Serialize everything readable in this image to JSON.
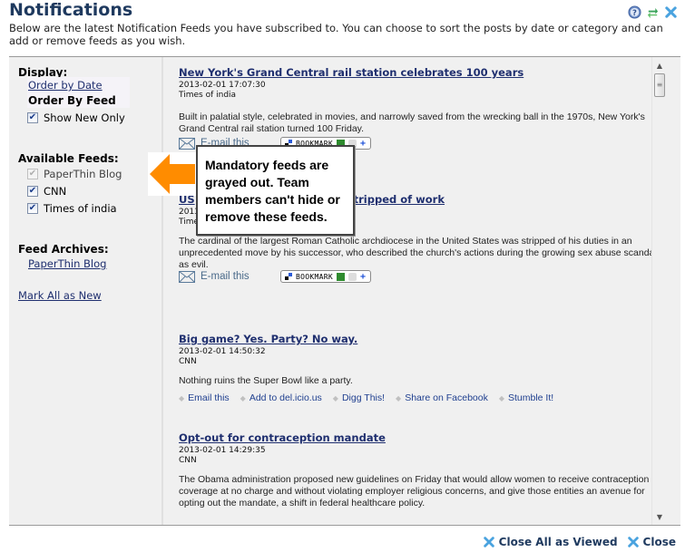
{
  "header": {
    "title": "Notifications",
    "description": "Below are the latest Notification Feeds you have subscribed to. You can choose to sort the posts by date or category and can add or remove feeds as you wish.",
    "icons": [
      "help-icon",
      "refresh-icon",
      "close-icon"
    ]
  },
  "sidebar": {
    "display_heading": "Display:",
    "order_by_date": "Order by Date",
    "order_by_feed": "Order By Feed",
    "show_new_only": {
      "label": "Show New Only",
      "checked": true
    },
    "available_feeds_heading": "Available Feeds:",
    "feeds": [
      {
        "label": "PaperThin Blog",
        "checked": true,
        "disabled": true
      },
      {
        "label": "CNN",
        "checked": true,
        "disabled": false
      },
      {
        "label": "Times of india",
        "checked": true,
        "disabled": false
      }
    ],
    "archives_heading": "Feed Archives:",
    "archives": [
      "PaperThin Blog"
    ],
    "mark_all_new": "Mark All as New"
  },
  "callout": {
    "text": "Mandatory feeds are grayed out.  Team members can't hide or remove these feeds.",
    "arrow_color": "#ff8c00"
  },
  "items": [
    {
      "title": "New York's Grand Central rail station celebrates 100 years",
      "date": "2013-02-01 17:07:30",
      "source": "Times of india",
      "body": "Built in palatial style, celebrated in movies, and narrowly saved from the wrecking ball in the 1970s, New York's Grand Central rail station turned 100 Friday.",
      "email_label": "E-mail this",
      "bookmark_label": "BOOKMARK"
    },
    {
      "title": "US cardinal stripped of work",
      "title_visible_start": "US",
      "title_visible_end": "tripped of work",
      "date": "2013",
      "source": "Time",
      "body": "The cardinal of the largest Roman Catholic archdiocese in the United States was stripped of his duties in an unprecedented move by his successor, who described the church's actions during the growing sex abuse scandal as evil.",
      "email_label": "E-mail this",
      "bookmark_label": "BOOKMARK"
    },
    {
      "title": "Big game? Yes. Party? No way.",
      "date": "2013-02-01 14:50:32",
      "source": "CNN",
      "body": "Nothing ruins the Super Bowl like a party.",
      "share_links": [
        "Email this",
        "Add to del.icio.us",
        "Digg This!",
        "Share on Facebook",
        "Stumble It!"
      ]
    },
    {
      "title": "Opt-out for contraception mandate",
      "date": "2013-02-01 14:29:35",
      "source": "CNN",
      "body": "The Obama administration proposed new guidelines on Friday that would allow women to receive contraception coverage at no charge and without violating employer religious concerns, and give those entities an avenue for opting out the mandate, a shift in federal healthcare policy."
    }
  ],
  "footer": {
    "close_all_viewed": "Close All as Viewed",
    "close": "Close"
  },
  "colors": {
    "title": "#1f3a5f",
    "link": "#1f2f6f",
    "panel_bg": "#f0f0f0",
    "close_icon": "#4aa3df",
    "refresh_icon": "#3aa35a"
  }
}
